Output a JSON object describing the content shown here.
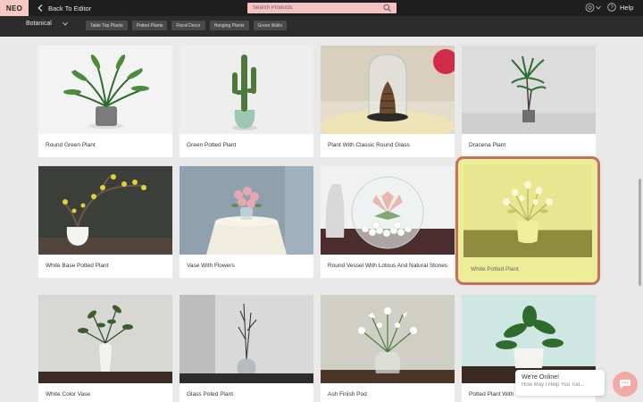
{
  "topbar": {
    "logo": "NEO",
    "back_label": "Back To Editor",
    "search_placeholder": "Search Products",
    "help_label": "Help"
  },
  "subbar": {
    "category": "Botanical",
    "tabs": [
      "Table Top Plants",
      "Potted Plants",
      "Floral Decor",
      "Hanging Plants",
      "Green Walls"
    ]
  },
  "products": [
    {
      "name": "Round Green Plant"
    },
    {
      "name": "Green Potted Plant"
    },
    {
      "name": "Plant With Classic Round Glass"
    },
    {
      "name": "Dracena Plant"
    },
    {
      "name": "White Base Potted Plant"
    },
    {
      "name": "Vase With Flowers"
    },
    {
      "name": "Round Vessel With Lotous And Natural Stones"
    },
    {
      "name": "White Potted Plant",
      "selected": true
    },
    {
      "name": "White Color Vase"
    },
    {
      "name": "Glass Poted Plant"
    },
    {
      "name": "Ash Finish Pod"
    },
    {
      "name": "Potted Plant With"
    }
  ],
  "chat": {
    "title": "We're Online!",
    "subtitle": "How May I Help You Tod..."
  },
  "colors": {
    "accent": "#f4c2c0",
    "selected_border": "#c2735d",
    "selected_bg": "#eeed97"
  }
}
